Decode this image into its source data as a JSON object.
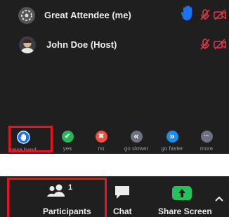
{
  "participants": [
    {
      "name": "Great Attendee (me)",
      "icon": "avatar-icon",
      "status": [
        "raised-hand-icon",
        "mic-muted-icon",
        "video-off-icon"
      ]
    },
    {
      "name": "John Doe (Host)",
      "icon": "avatar-icon",
      "status": [
        "mic-muted-icon",
        "video-off-icon"
      ]
    }
  ],
  "reactions": [
    {
      "label": "raise hand",
      "icon": "hand-icon",
      "color": "#1d72f3",
      "glyph": ""
    },
    {
      "label": "yes",
      "icon": "check-icon",
      "color": "#2ab55d",
      "glyph": "✔"
    },
    {
      "label": "no",
      "icon": "x-icon",
      "color": "#ee4f43",
      "glyph": "✖"
    },
    {
      "label": "go slower",
      "icon": "rewind-icon",
      "color": "#6e7180",
      "glyph": "«"
    },
    {
      "label": "go faster",
      "icon": "fast-forward-icon",
      "color": "#1c8cf5",
      "glyph": "»"
    },
    {
      "label": "more",
      "icon": "ellipsis-icon",
      "color": "#6e7180",
      "glyph": "•••"
    }
  ],
  "toolbar": {
    "participants_label": "Participants",
    "participants_count": "1",
    "chat_label": "Chat",
    "share_label": "Share Screen"
  },
  "colors": {
    "highlight": "#e8141c",
    "share_green": "#22c35b",
    "muted_red": "#e6384a",
    "hand_blue": "#1d72f3"
  }
}
